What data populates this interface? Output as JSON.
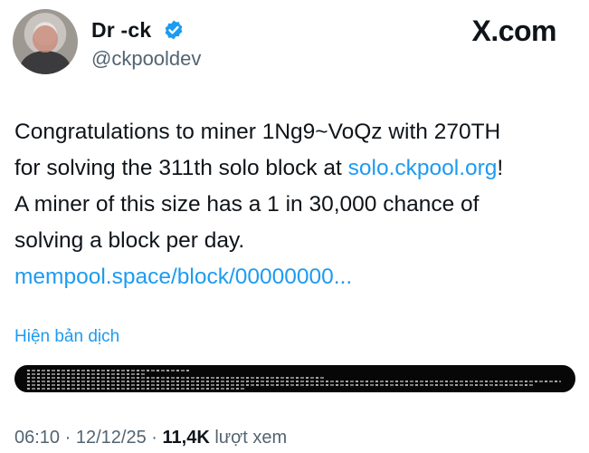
{
  "author": {
    "display_name": "Dr -ck",
    "handle": "@ckpooldev"
  },
  "brand": "X.com",
  "tweet": {
    "line1": "Congratulations to miner 1Ng9~VoQz with 270TH",
    "line2_prefix": "for solving the 311th solo block at ",
    "line2_link": "solo.ckpool.org",
    "line2_suffix": "!",
    "line3": "A miner of this size has a 1 in 30,000 chance of",
    "line4": "solving a block per day.",
    "link": "mempool.space/block/00000000..."
  },
  "translate_label": "Hiện bản dịch",
  "meta": {
    "time": "06:10",
    "date": "12/12/25",
    "views": "11,4K",
    "views_label": "lượt xem",
    "separator": "·"
  },
  "colors": {
    "link": "#1d9bf0",
    "verified": "#1d9bf0",
    "text": "#0f1419",
    "muted": "#536471"
  },
  "icons": [
    "verified-badge-icon"
  ]
}
